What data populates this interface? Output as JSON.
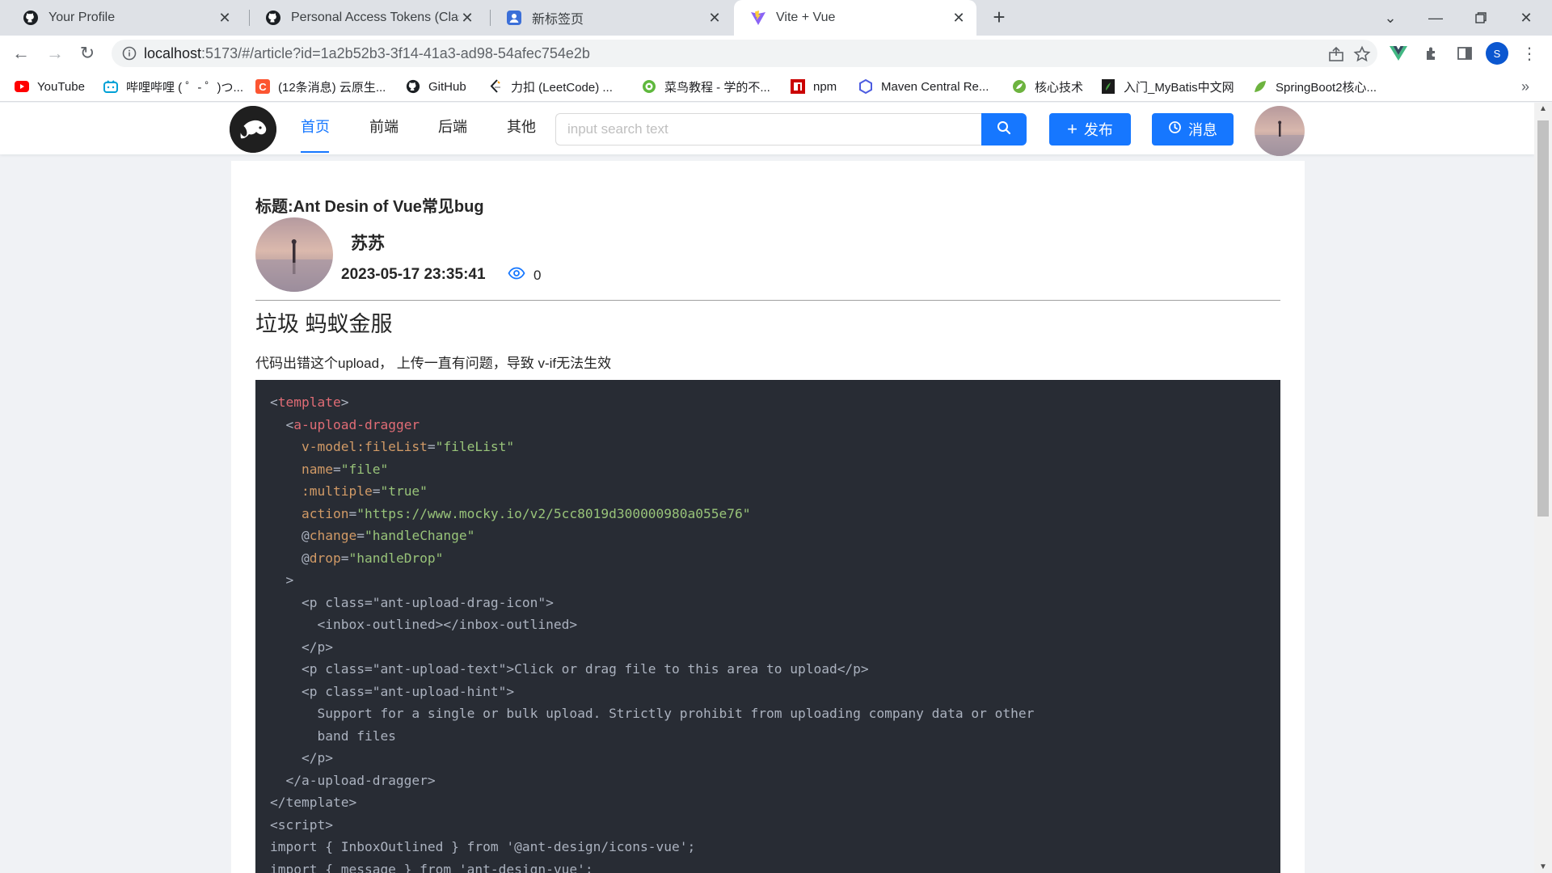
{
  "browser": {
    "tabs": [
      {
        "title": "Your Profile",
        "icon": "github-icon"
      },
      {
        "title": "Personal Access Tokens (Classic)",
        "icon": "github-icon"
      },
      {
        "title": "新标签页",
        "icon": "new-tab-icon"
      },
      {
        "title": "Vite + Vue",
        "icon": "vite-icon",
        "active": true
      }
    ],
    "url_host": "localhost",
    "url_rest": ":5173/#/article?id=1a2b52b3-3f14-41a3-ad98-54afec754e2b",
    "profile_initial": "S",
    "bookmarks": [
      {
        "label": "YouTube",
        "icon": "youtube-icon"
      },
      {
        "label": "哔哩哔哩 ( ゜- ゜)つ...",
        "icon": "bilibili-icon"
      },
      {
        "label": "(12条消息) 云原生...",
        "icon": "csdn-icon"
      },
      {
        "label": "GitHub",
        "icon": "github-icon"
      },
      {
        "label": "力扣 (LeetCode) ...",
        "icon": "leetcode-icon"
      },
      {
        "label": "菜鸟教程 - 学的不...",
        "icon": "runoob-icon"
      },
      {
        "label": "npm",
        "icon": "npm-icon"
      },
      {
        "label": "Maven Central Re...",
        "icon": "maven-icon"
      },
      {
        "label": "核心技术",
        "icon": "spring-icon"
      },
      {
        "label": "入门_MyBatis中文网",
        "icon": "mybatis-icon"
      },
      {
        "label": "SpringBoot2核心...",
        "icon": "springboot-icon"
      }
    ],
    "bookmarks_more": "»"
  },
  "site": {
    "nav": [
      "首页",
      "前端",
      "后端",
      "其他"
    ],
    "search_placeholder": "input search text",
    "publish_label": "发布",
    "messages_label": "消息"
  },
  "article": {
    "title": "标题:Ant Desin of Vue常见bug",
    "author": "苏苏",
    "date": "2023-05-17 23:35:41",
    "views": "0",
    "heading": "垃圾 蚂蚁金服",
    "paragraph": "代码出错这个upload， 上传一直有问题，导致 v-if无法生效",
    "code_lines": [
      [
        {
          "t": "<",
          "c": "plain"
        },
        {
          "t": "template",
          "c": "tag"
        },
        {
          "t": ">",
          "c": "plain"
        }
      ],
      [
        {
          "t": "  <",
          "c": "plain"
        },
        {
          "t": "a-upload-dragger",
          "c": "tag"
        }
      ],
      [
        {
          "t": "    ",
          "c": "plain"
        },
        {
          "t": "v-model:fileList",
          "c": "attr"
        },
        {
          "t": "=",
          "c": "plain"
        },
        {
          "t": "\"fileList\"",
          "c": "str"
        }
      ],
      [
        {
          "t": "    ",
          "c": "plain"
        },
        {
          "t": "name",
          "c": "attr"
        },
        {
          "t": "=",
          "c": "plain"
        },
        {
          "t": "\"file\"",
          "c": "str"
        }
      ],
      [
        {
          "t": "    ",
          "c": "plain"
        },
        {
          "t": ":multiple",
          "c": "attr"
        },
        {
          "t": "=",
          "c": "plain"
        },
        {
          "t": "\"true\"",
          "c": "str"
        }
      ],
      [
        {
          "t": "    ",
          "c": "plain"
        },
        {
          "t": "action",
          "c": "attr"
        },
        {
          "t": "=",
          "c": "plain"
        },
        {
          "t": "\"https://www.mocky.io/v2/5cc8019d300000980a055e76\"",
          "c": "str"
        }
      ],
      [
        {
          "t": "    @",
          "c": "plain"
        },
        {
          "t": "change",
          "c": "attr"
        },
        {
          "t": "=",
          "c": "plain"
        },
        {
          "t": "\"handleChange\"",
          "c": "str"
        }
      ],
      [
        {
          "t": "    @",
          "c": "plain"
        },
        {
          "t": "drop",
          "c": "attr"
        },
        {
          "t": "=",
          "c": "plain"
        },
        {
          "t": "\"handleDrop\"",
          "c": "str"
        }
      ],
      [
        {
          "t": "  >",
          "c": "plain"
        }
      ],
      [
        {
          "t": "    <p class=\"ant-upload-drag-icon\">",
          "c": "plain"
        }
      ],
      [
        {
          "t": "      <inbox-outlined></inbox-outlined>",
          "c": "plain"
        }
      ],
      [
        {
          "t": "    </p>",
          "c": "plain"
        }
      ],
      [
        {
          "t": "    <p class=\"ant-upload-text\">Click or drag file to this area to upload</p>",
          "c": "plain"
        }
      ],
      [
        {
          "t": "    <p class=\"ant-upload-hint\">",
          "c": "plain"
        }
      ],
      [
        {
          "t": "      Support for a single or bulk upload. Strictly prohibit from uploading company data or other",
          "c": "plain"
        }
      ],
      [
        {
          "t": "      band files",
          "c": "plain"
        }
      ],
      [
        {
          "t": "    </p>",
          "c": "plain"
        }
      ],
      [
        {
          "t": "  </a-upload-dragger>",
          "c": "plain"
        }
      ],
      [
        {
          "t": "</template>",
          "c": "plain"
        }
      ],
      [
        {
          "t": "<script>",
          "c": "plain"
        }
      ],
      [
        {
          "t": "import { InboxOutlined } from '@ant-design/icons-vue';",
          "c": "plain"
        }
      ],
      [
        {
          "t": "import { message } from 'ant-design-vue';",
          "c": "plain"
        }
      ]
    ]
  },
  "colors": {
    "accent": "#1677ff",
    "code_bg": "#282c34",
    "code_tag": "#e06c75",
    "code_attr": "#d19a66",
    "code_string": "#98c379"
  }
}
